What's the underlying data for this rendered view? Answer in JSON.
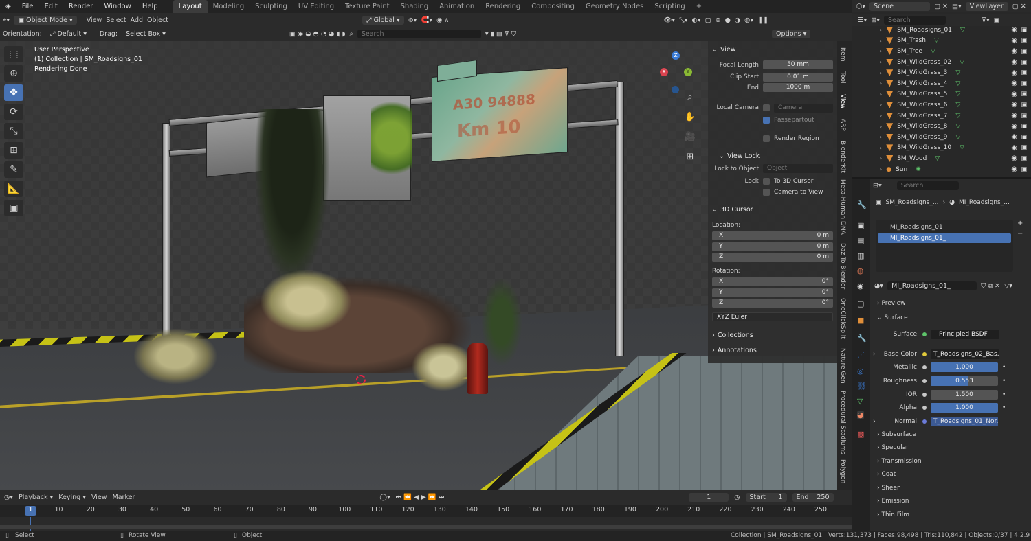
{
  "topbar": {
    "menus": [
      "File",
      "Edit",
      "Render",
      "Window",
      "Help"
    ],
    "workspaces": [
      "Layout",
      "Modeling",
      "Sculpting",
      "UV Editing",
      "Texture Paint",
      "Shading",
      "Animation",
      "Rendering",
      "Compositing",
      "Geometry Nodes",
      "Scripting"
    ],
    "active_workspace": "Layout",
    "scene": "Scene",
    "view_layer": "ViewLayer"
  },
  "header": {
    "mode": "Object Mode",
    "menus": [
      "View",
      "Select",
      "Add",
      "Object"
    ],
    "transform": "Global",
    "orientation_label": "Orientation:",
    "orientation": "Default",
    "drag_label": "Drag:",
    "drag": "Select Box",
    "search_placeholder": "Search",
    "options": "Options"
  },
  "viewport_info": {
    "line1": "User Perspective",
    "line2": "(1) Collection | SM_Roadsigns_01",
    "line3": "Rendering Done"
  },
  "scene_text": {
    "sign_line1": "A30 94888",
    "sign_line2": "Km 10"
  },
  "gizmo": {
    "x": "X",
    "y": "Y",
    "z": "Z"
  },
  "npanel": {
    "view": {
      "title": "View",
      "focal_length_label": "Focal Length",
      "focal_length": "50 mm",
      "clip_start_label": "Clip Start",
      "clip_start": "0.01 m",
      "end_label": "End",
      "end": "1000 m",
      "local_camera_label": "Local Camera",
      "camera_placeholder": "Camera",
      "passepartout": "Passepartout",
      "render_region": "Render Region"
    },
    "view_lock": {
      "title": "View Lock",
      "lock_to_object_label": "Lock to Object",
      "object_placeholder": "Object",
      "lock_label": "Lock",
      "to_3d_cursor": "To 3D Cursor",
      "camera_to_view": "Camera to View"
    },
    "cursor": {
      "title": "3D Cursor",
      "location_label": "Location:",
      "x_label": "X",
      "x": "0 m",
      "y_label": "Y",
      "y": "0 m",
      "z_label": "Z",
      "z": "0 m",
      "rotation_label": "Rotation:",
      "rx": "0°",
      "ry": "0°",
      "rz": "0°",
      "rotation_mode": "XYZ Euler"
    },
    "collections": "Collections",
    "annotations": "Annotations"
  },
  "ntabs": [
    "Item",
    "Tool",
    "View",
    "ARP",
    "BlenderKit",
    "Meta-Human DNA",
    "Daz To Blender",
    "OneClickSplit",
    "Nature Gen",
    "Procedural Stadiums",
    "Polygon"
  ],
  "timeline": {
    "playback": "Playback",
    "keying": "Keying",
    "view": "View",
    "marker": "Marker",
    "current_frame": "1",
    "start_label": "Start",
    "start": "1",
    "end_label": "End",
    "end": "250",
    "ticks": [
      "1",
      "10",
      "20",
      "30",
      "40",
      "50",
      "60",
      "70",
      "80",
      "90",
      "100",
      "110",
      "120",
      "130",
      "140",
      "150",
      "160",
      "170",
      "180",
      "190",
      "200",
      "210",
      "220",
      "230",
      "240",
      "250"
    ]
  },
  "status": {
    "select": "Select",
    "rotate": "Rotate View",
    "object": "Object",
    "collection": "Collection | SM_Roadsigns_01",
    "verts": "Verts:131,373",
    "faces": "Faces:98,498",
    "tris": "Tris:110,842",
    "objects": "Objects:0/37",
    "version": "4.2.9"
  },
  "outliner": {
    "search_placeholder": "Search",
    "items": [
      "SM_Roadsigns_01",
      "SM_Trash",
      "SM_Tree",
      "SM_WildGrass_02",
      "SM_WildGrass_3",
      "SM_WildGrass_4",
      "SM_WildGrass_5",
      "SM_WildGrass_6",
      "SM_WildGrass_7",
      "SM_WildGrass_8",
      "SM_WildGrass_9",
      "SM_WildGrass_10",
      "SM_Wood",
      "Sun"
    ]
  },
  "properties": {
    "search_placeholder": "Search",
    "breadcrumb_object": "SM_Roadsigns_...",
    "breadcrumb_material": "MI_Roadsigns_...",
    "slots": [
      "MI_Roadsigns_01",
      "MI_Roadsigns_01_"
    ],
    "material_name": "MI_Roadsigns_01_",
    "preview": "Preview",
    "surface_section": "Surface",
    "surface_label": "Surface",
    "surface": "Principled BSDF",
    "base_color_label": "Base Color",
    "base_color": "T_Roadsigns_02_Bas...",
    "metallic_label": "Metallic",
    "metallic": "1.000",
    "roughness_label": "Roughness",
    "roughness": "0.553",
    "ior_label": "IOR",
    "ior": "1.500",
    "alpha_label": "Alpha",
    "alpha": "1.000",
    "normal_label": "Normal",
    "normal": "T_Roadsigns_01_Nor...",
    "subsections": [
      "Subsurface",
      "Specular",
      "Transmission",
      "Coat",
      "Sheen",
      "Emission",
      "Thin Film"
    ]
  },
  "colors": {
    "accent": "#4772b3",
    "object_orange": "#e08f3a",
    "green": "#5ec46a"
  }
}
